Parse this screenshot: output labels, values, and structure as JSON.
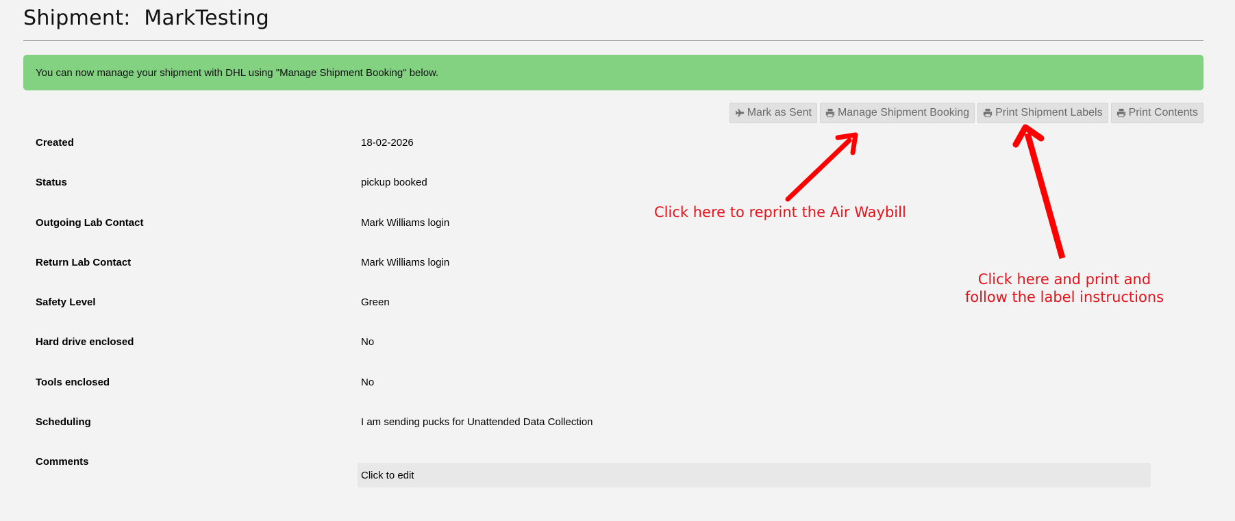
{
  "header": {
    "title": "Shipment:  MarkTesting"
  },
  "alert": {
    "message": "You can now manage your shipment with DHL using \"Manage Shipment Booking\" below.",
    "color": "#82d282"
  },
  "toolbar": {
    "buttons": [
      {
        "label": "Mark as Sent",
        "icon": "plane-icon"
      },
      {
        "label": "Manage Shipment Booking",
        "icon": "printer-icon"
      },
      {
        "label": "Print Shipment Labels",
        "icon": "printer-icon"
      },
      {
        "label": "Print Contents",
        "icon": "printer-icon"
      }
    ]
  },
  "details": [
    {
      "label": "Created",
      "value": "18-02-2026"
    },
    {
      "label": "Status",
      "value": "pickup booked"
    },
    {
      "label": "Outgoing Lab Contact",
      "value": "Mark Williams login"
    },
    {
      "label": "Return Lab Contact",
      "value": "Mark Williams login"
    },
    {
      "label": "Safety Level",
      "value": "Green"
    },
    {
      "label": "Hard drive enclosed",
      "value": "No"
    },
    {
      "label": "Tools enclosed",
      "value": "No"
    },
    {
      "label": "Scheduling",
      "value": "I am sending pucks for Unattended Data Collection"
    },
    {
      "label": "Comments",
      "value": ""
    }
  ],
  "comments": {
    "placeholder": "Click to edit"
  },
  "annotations": {
    "reprint": "Click here to reprint the Air Waybill",
    "labels_line1": "Click here and print and",
    "labels_line2": "follow the label instructions",
    "color": "#e5131b"
  }
}
